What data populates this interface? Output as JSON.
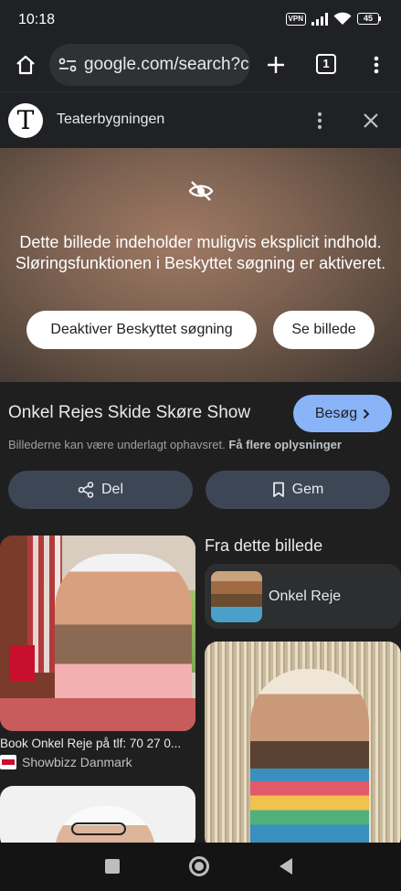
{
  "status": {
    "time": "10:18",
    "vpn": "VPN",
    "battery": "45"
  },
  "toolbar": {
    "url": "google.com/search?c",
    "tab_count": "1"
  },
  "site": {
    "logo_letter": "T",
    "name": "Teaterbygningen"
  },
  "preview": {
    "message": "Dette billede indeholder muligvis eksplicit indhold. Sløringsfunktionen i Beskyttet søgning er aktiveret.",
    "deactivate_label": "Deaktiver Beskyttet søgning",
    "see_label": "Se billede"
  },
  "result": {
    "title": "Onkel Rejes Skide Skøre Show",
    "visit_label": "Besøg",
    "copyright": "Billederne kan være underlagt ophavsret.",
    "more_info": "Få flere oplysninger",
    "share_label": "Del",
    "save_label": "Gem"
  },
  "grid": {
    "left_caption": "Book Onkel Reje på tlf: 70 27 0...",
    "left_source": "Showbizz Danmark",
    "from_title": "Fra dette billede",
    "entity_name": "Onkel Reje"
  },
  "colors": {
    "accent_blue": "#8ab4f8",
    "pill_bg": "#3c4655",
    "background": "#1f1f1f"
  }
}
